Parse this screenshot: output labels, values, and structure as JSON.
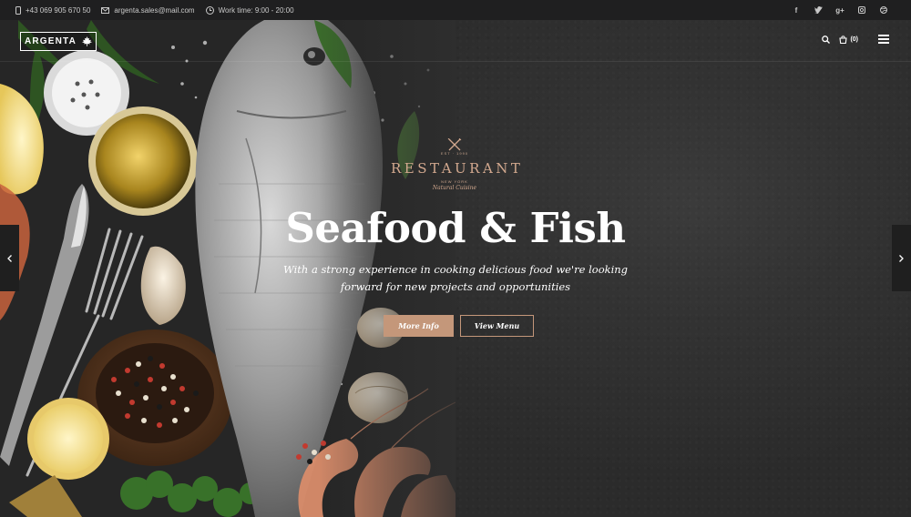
{
  "topbar": {
    "phone": "+43 069 905 670 50",
    "email": "argenta.sales@mail.com",
    "hours": "Work time: 9:00 - 20:00",
    "social": [
      "f",
      "t",
      "g+",
      "ig",
      "dr"
    ]
  },
  "header": {
    "logo": "ARGENTA",
    "cart_count": "(0)"
  },
  "hero": {
    "emblem": {
      "est": "EST · 1990",
      "name": "RESTAURANT",
      "city": "NEW YORK",
      "tagline": "Natural Cuisine"
    },
    "title": "Seafood & Fish",
    "subtitle_line1": "With a strong experience in cooking delicious food we're looking",
    "subtitle_line2": "forward for new projects and opportunities",
    "btn_more": "More Info",
    "btn_menu": "View Menu"
  },
  "icons": {
    "prev": "chevron-left-icon",
    "next": "chevron-right-icon",
    "search": "search-icon",
    "cart": "cart-icon",
    "menu": "hamburger-icon"
  },
  "colors": {
    "accent": "#c4977a",
    "topbar_bg": "#1f1f20",
    "hero_bg": "#2f2f2f"
  }
}
